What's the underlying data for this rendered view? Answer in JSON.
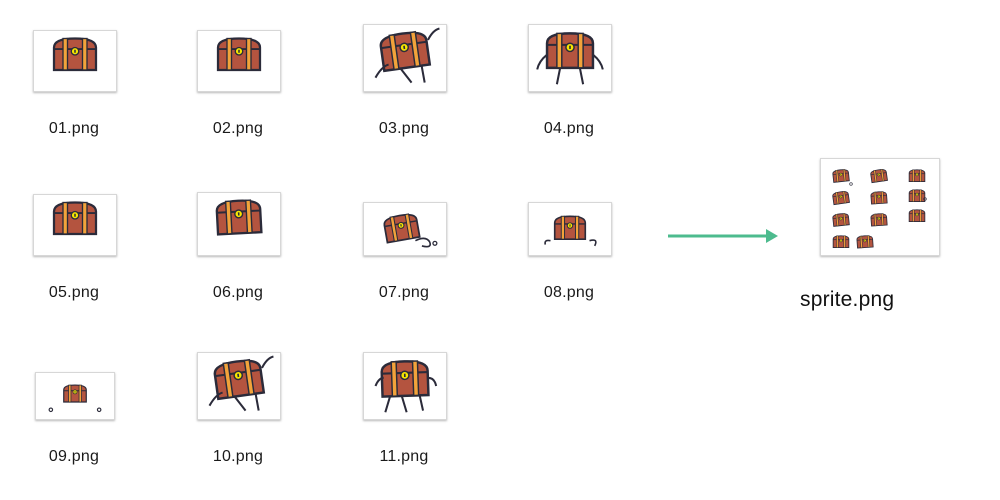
{
  "files": [
    {
      "name": "01.png",
      "pose": "closed"
    },
    {
      "name": "02.png",
      "pose": "closed"
    },
    {
      "name": "03.png",
      "pose": "walk-tilt"
    },
    {
      "name": "04.png",
      "pose": "legs"
    },
    {
      "name": "05.png",
      "pose": "closed"
    },
    {
      "name": "06.png",
      "pose": "closed-tilt"
    },
    {
      "name": "07.png",
      "pose": "tilt-tail"
    },
    {
      "name": "08.png",
      "pose": "low-dots"
    },
    {
      "name": "09.png",
      "pose": "small-dots"
    },
    {
      "name": "10.png",
      "pose": "walk-tilt"
    },
    {
      "name": "11.png",
      "pose": "walk"
    }
  ],
  "sprite": {
    "name": "sprite.png"
  },
  "colors": {
    "wood": "#b4543f",
    "outline": "#2b2b3a",
    "band": "#f2a33a",
    "lock": "#f6e600",
    "arrow": "#4dbb8e"
  }
}
